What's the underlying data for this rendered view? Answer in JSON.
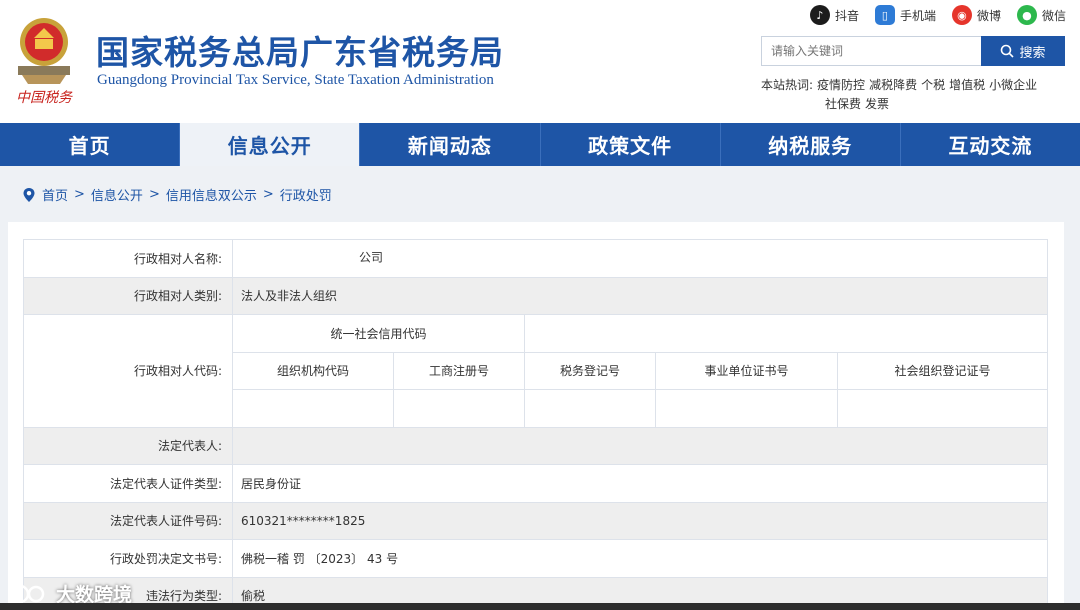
{
  "header": {
    "title_cn": "国家税务总局广东省税务局",
    "title_en": "Guangdong Provincial Tax Service, State Taxation Administration",
    "emblem_text": "中国税务",
    "social": [
      {
        "label": "抖音",
        "icon": "douyin-icon",
        "color": "#1c1c1c"
      },
      {
        "label": "手机端",
        "icon": "mobile-icon",
        "color": "#2e7bd6"
      },
      {
        "label": "微博",
        "icon": "weibo-icon",
        "color": "#e6352b"
      },
      {
        "label": "微信",
        "icon": "wechat-icon",
        "color": "#2db84d"
      }
    ],
    "search": {
      "placeholder": "请输入关键词",
      "button": "搜索"
    },
    "hot_label": "本站热词:",
    "hot_words": [
      "疫情防控",
      "减税降费",
      "个税",
      "增值税",
      "小微企业",
      "社保费",
      "发票"
    ]
  },
  "nav": {
    "items": [
      "首页",
      "信息公开",
      "新闻动态",
      "政策文件",
      "纳税服务",
      "互动交流"
    ],
    "active_index": 1
  },
  "breadcrumb": [
    "首页",
    "信息公开",
    "信用信息双公示",
    "行政处罚"
  ],
  "table": {
    "name_label": "行政相对人名称:",
    "name_value": "公司",
    "type_label": "行政相对人类别:",
    "type_value": "法人及非法人组织",
    "code_label": "行政相对人代码:",
    "credit_code_label": "统一社会信用代码",
    "code_headers": [
      "组织机构代码",
      "工商注册号",
      "税务登记号",
      "事业单位证书号",
      "社会组织登记证号"
    ],
    "legal_rep_label": "法定代表人:",
    "id_type_label": "法定代表人证件类型:",
    "id_type_value": "居民身份证",
    "id_no_label": "法定代表人证件号码:",
    "id_no_value": "610321********1825",
    "decision_label": "行政处罚决定文书号:",
    "decision_value": "佛税一稽 罚 〔2023〕 43 号",
    "violation_label": "违法行为类型:",
    "violation_value": "偷税"
  },
  "watermark": "大数跨境",
  "colors": {
    "brand_blue": "#1e55a6",
    "nav_active_bg": "#eef2f7"
  }
}
